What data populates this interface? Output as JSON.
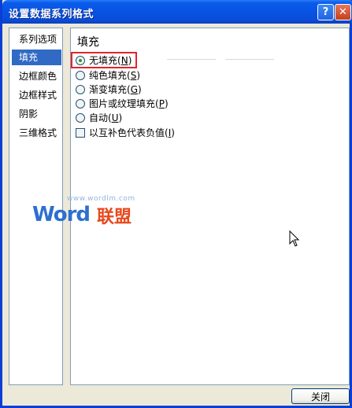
{
  "window": {
    "title": "设置数据系列格式",
    "help_glyph": "?",
    "close_glyph": "✕"
  },
  "sidebar": {
    "items": [
      {
        "label": "系列选项",
        "selected": false
      },
      {
        "label": "填充",
        "selected": true
      },
      {
        "label": "边框颜色",
        "selected": false
      },
      {
        "label": "边框样式",
        "selected": false
      },
      {
        "label": "阴影",
        "selected": false
      },
      {
        "label": "三维格式",
        "selected": false
      }
    ]
  },
  "panel": {
    "title": "填充",
    "options": [
      {
        "label": "无填充",
        "key": "N",
        "type": "radio",
        "checked": true
      },
      {
        "label": "纯色填充",
        "key": "S",
        "type": "radio",
        "checked": false
      },
      {
        "label": "渐变填充",
        "key": "G",
        "type": "radio",
        "checked": false
      },
      {
        "label": "图片或纹理填充",
        "key": "P",
        "type": "radio",
        "checked": false
      },
      {
        "label": "自动",
        "key": "U",
        "type": "radio",
        "checked": false
      },
      {
        "label": "以互补色代表负值",
        "key": "I",
        "type": "checkbox",
        "checked": false
      }
    ]
  },
  "watermark": {
    "url": "www.wordlm.com",
    "word": "Word",
    "cn": "联盟"
  },
  "footer": {
    "close_label": "关闭"
  },
  "colors": {
    "title_bar": "#0A5CEB",
    "selection": "#316AC5",
    "highlight_box": "#E3232B",
    "watermark_blue": "#2D6FD0",
    "watermark_orange": "#E8481C"
  }
}
